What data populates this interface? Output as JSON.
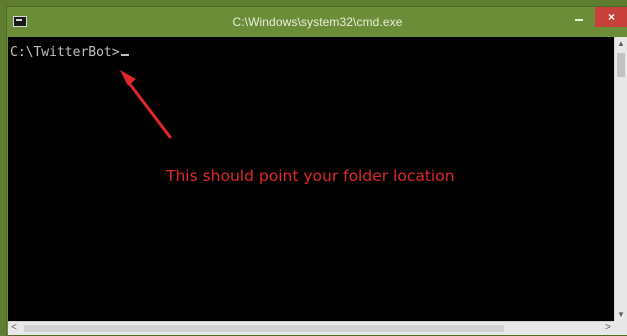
{
  "window": {
    "title": "C:\\Windows\\system32\\cmd.exe",
    "app_icon": "cmd-icon",
    "controls": {
      "minimize_icon": "minimize-icon",
      "maximize_icon": "maximize-icon",
      "close_label": "×"
    },
    "titlebar_color": "#6c8d37",
    "close_color": "#c7413a"
  },
  "console": {
    "prompt": "C:\\TwitterBot>",
    "background": "#000000",
    "text_color": "#c0c0c0"
  },
  "annotation": {
    "text": "This should point your folder location",
    "color": "#e0282a",
    "arrow_icon": "arrow-icon"
  },
  "scrollbars": {
    "up_glyph": "▲",
    "down_glyph": "▼",
    "left_glyph": "<",
    "right_glyph": ">"
  }
}
